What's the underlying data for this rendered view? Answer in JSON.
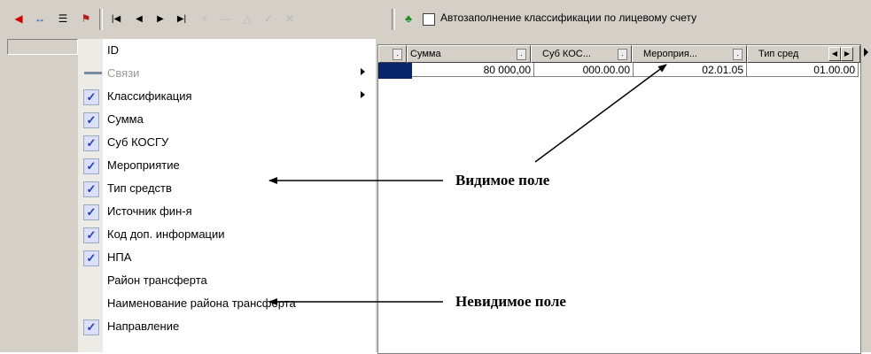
{
  "toolbar": {
    "autofill_label": "Автозаполнение классификации по лицевому счету",
    "icons": [
      "exit-icon",
      "link-arrows-icon",
      "list-settings-icon",
      "flag-icon",
      "first-record-icon",
      "prev-record-icon",
      "next-record-icon",
      "last-record-icon",
      "insert-icon",
      "delete-icon",
      "edit-icon",
      "post-icon",
      "cancel-icon",
      "tree-icon"
    ],
    "autofill_checked": false
  },
  "menu": {
    "items": [
      {
        "label": "ID",
        "checked": false,
        "submenu": false,
        "disabled": false
      },
      {
        "label": "Связи",
        "checked": false,
        "submenu": true,
        "disabled": true,
        "icon": "link-icon"
      },
      {
        "label": "Классификация",
        "checked": true,
        "submenu": true,
        "disabled": false
      },
      {
        "label": "Сумма",
        "checked": true,
        "submenu": false,
        "disabled": false
      },
      {
        "label": "Суб КОСГУ",
        "checked": true,
        "submenu": false,
        "disabled": false
      },
      {
        "label": "Мероприятие",
        "checked": true,
        "submenu": false,
        "disabled": false
      },
      {
        "label": "Тип средств",
        "checked": true,
        "submenu": false,
        "disabled": false
      },
      {
        "label": "Источник фин-я",
        "checked": true,
        "submenu": false,
        "disabled": false
      },
      {
        "label": "Код доп. информации",
        "checked": true,
        "submenu": false,
        "disabled": false
      },
      {
        "label": "НПА",
        "checked": true,
        "submenu": false,
        "disabled": false
      },
      {
        "label": "Район трансферта",
        "checked": false,
        "submenu": false,
        "disabled": false
      },
      {
        "label": "Наименование района трансферта",
        "checked": false,
        "submenu": false,
        "disabled": false
      },
      {
        "label": "Направление",
        "checked": true,
        "submenu": false,
        "disabled": false
      }
    ]
  },
  "grid": {
    "columns": [
      "Сумма",
      "Суб КОС...",
      "Мероприя...",
      "Тип сред"
    ],
    "rows": [
      [
        "80 000,00",
        "000.00.00",
        "02.01.05",
        "01.00.00"
      ]
    ]
  },
  "annotations": {
    "visible_field": "Видимое поле",
    "invisible_field": "Невидимое  поле"
  },
  "colors": {
    "selection": "#0a246a",
    "toolbar_bg": "#d4d0c8",
    "check_color": "#1f3fae"
  }
}
